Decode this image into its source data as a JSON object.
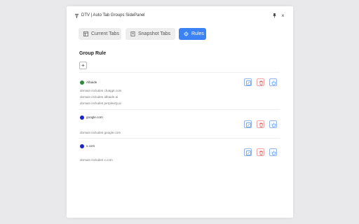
{
  "window": {
    "title": "DTV | Auto Tab Groups SidePanel"
  },
  "tabs": [
    {
      "label": "Current Tabs",
      "icon": "current-tabs-icon",
      "active": false
    },
    {
      "label": "Snapshot Tabs",
      "icon": "snapshot-tabs-icon",
      "active": false
    },
    {
      "label": "Rules",
      "icon": "rules-icon",
      "active": true
    }
  ],
  "section": {
    "title": "Group Rule",
    "add_label": "+"
  },
  "rules": [
    {
      "name": "Albaide",
      "color": "#2e8b3a",
      "conditions": [
        "domain includes chatgpt.com",
        "domain includes albaide.ai",
        "domain includes perplexity.ai"
      ]
    },
    {
      "name": "google.com",
      "color": "#1f22c9",
      "conditions": [
        "domain includes google.com"
      ]
    },
    {
      "name": "x.com",
      "color": "#1f22c9",
      "conditions": [
        "domain includes x.com"
      ]
    }
  ],
  "colors": {
    "accent": "#3b82f6",
    "danger": "#e05252",
    "background": "#e9e9eb"
  }
}
